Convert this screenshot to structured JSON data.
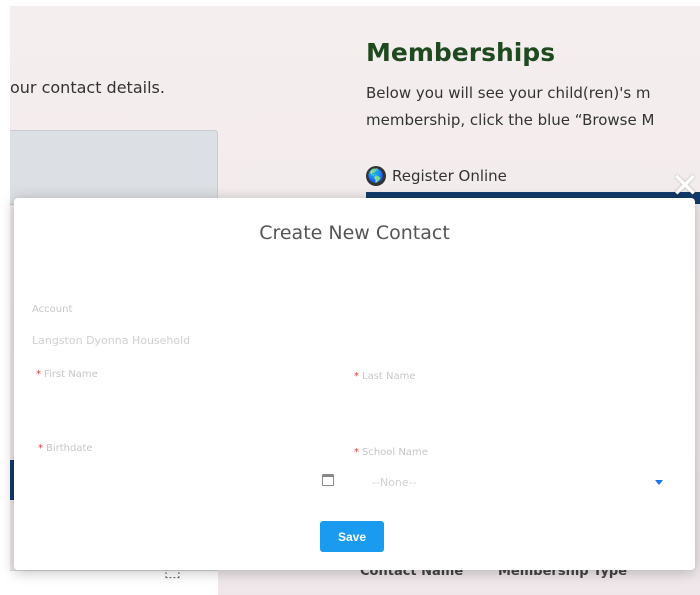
{
  "background": {
    "contact_text": "our contact details.",
    "memberships_title": "Memberships",
    "memberships_line1": "Below you will see your child(ren)'s m",
    "memberships_line2": "membership, click the blue “Browse M",
    "register_label": "Register Online",
    "table_contact_name": "Contact Name",
    "table_membership_type": "Membership Type"
  },
  "modal": {
    "title": "Create New Contact",
    "account_label": "Account",
    "account_value": "Langston Dyonna Household",
    "first_name_label": "First Name",
    "last_name_label": "Last Name",
    "birthdate_label": "Birthdate",
    "school_name_label": "School Name",
    "school_name_value": "--None--",
    "save_label": "Save",
    "close_label": "✕"
  },
  "colors": {
    "save_button": "#1a9bf0",
    "required_marker": "#e03b3b",
    "memberships_title": "#1f4a20",
    "navy_bar": "#123a6a"
  }
}
